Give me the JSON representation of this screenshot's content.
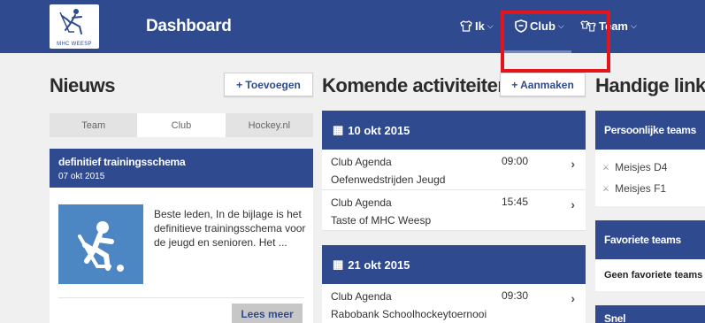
{
  "header": {
    "logo_text": "MHC WEESP",
    "title": "Dashboard",
    "nav": [
      {
        "label": "Ik",
        "icon": "shirt-icon"
      },
      {
        "label": "Club",
        "icon": "shield-icon"
      },
      {
        "label": "Team",
        "icon": "team-shirts-icon"
      }
    ]
  },
  "news": {
    "title": "Nieuws",
    "add_label": "+ Toevoegen",
    "tabs": [
      "Team",
      "Club",
      "Hockey.nl"
    ],
    "active_tab": "Club",
    "item": {
      "title": "definitief trainingsschema",
      "date": "07 okt 2015",
      "text": "Beste leden, In de bijlage is het definitieve trainingsschema voor de jeugd en senioren. Het ...",
      "more_label": "Lees meer"
    }
  },
  "activities": {
    "title": "Komende activiteiten",
    "add_label": "+ Aanmaken",
    "days": [
      {
        "date": "10 okt 2015",
        "items": [
          {
            "category": "Club Agenda",
            "time": "09:00",
            "name": "Oefenwedstrijden Jeugd"
          },
          {
            "category": "Club Agenda",
            "time": "15:45",
            "name": "Taste of MHC Weesp"
          }
        ]
      },
      {
        "date": "21 okt 2015",
        "items": [
          {
            "category": "Club Agenda",
            "time": "09:30",
            "name": "Rabobank Schoolhockeytoernooi"
          }
        ]
      }
    ]
  },
  "links": {
    "title": "Handige links",
    "personal_title": "Persoonlijke teams",
    "personal_teams": [
      "Meisjes D4",
      "Meisjes F1"
    ],
    "favorites_title": "Favoriete teams",
    "favorites_empty": "Geen favoriete teams",
    "quick_title": "Snel"
  },
  "colors": {
    "primary": "#2f4a8f",
    "highlight": "#e3141b",
    "background": "#f0f0f0"
  }
}
